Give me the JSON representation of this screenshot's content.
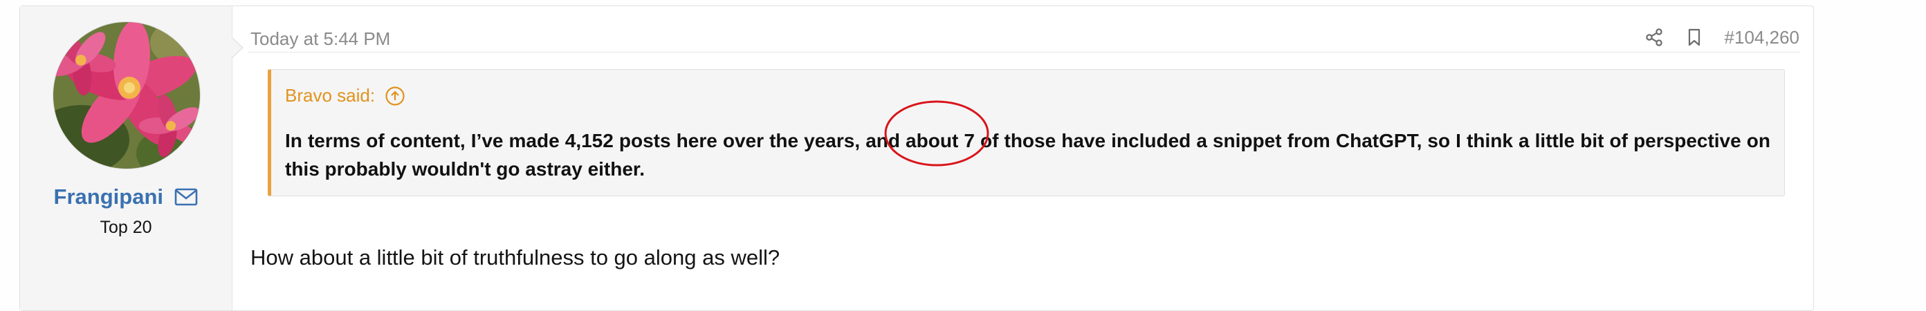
{
  "user": {
    "name": "Frangipani",
    "title": "Top 20",
    "avatar_icon": "frangipani-flower-avatar",
    "mail_icon": "envelope-icon"
  },
  "post": {
    "date": "Today at 5:44 PM",
    "number": "#104,260",
    "share_icon": "share-icon",
    "bookmark_icon": "bookmark-icon",
    "quote": {
      "author_label": "Bravo said:",
      "expand_icon": "arrow-up-circle-icon",
      "text": "In terms of content, I’ve made 4,152 posts here over the years, and about 7 of those have included a snippet from ChatGPT, so I think a little bit of perspective on this probably wouldn't go astray either."
    },
    "body": "How about a little bit of truthfulness to go along as well?"
  },
  "colors": {
    "username": "#3a71b0",
    "quote_accent": "#e8a23e",
    "quote_author": "#e0931e",
    "annotation_circle": "#d9141b"
  }
}
